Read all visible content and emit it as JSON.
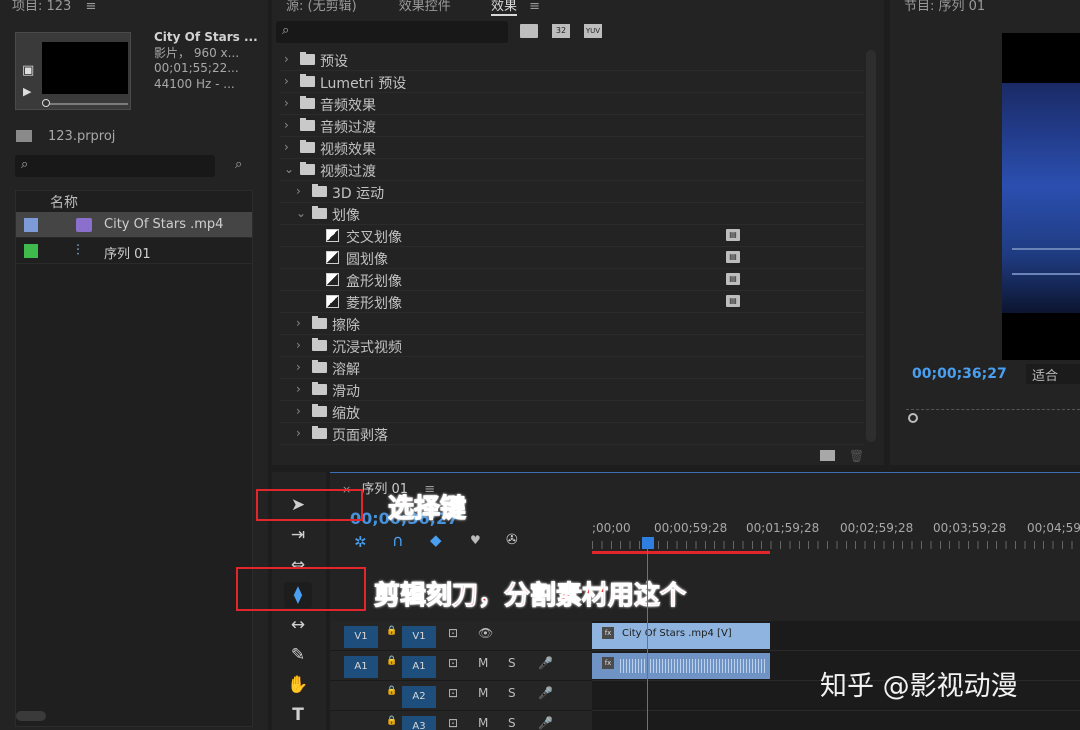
{
  "project": {
    "header": "项目: 123",
    "menu_icon": "≡",
    "clip_name": "City Of Stars ...",
    "meta_line1": "影片， 960 x...",
    "meta_line2": "00;01;55;22...",
    "meta_line3": "44100 Hz - ...",
    "project_file": "123.prproj",
    "column_name": "名称",
    "items": [
      {
        "label": "City Of Stars .mp4",
        "color": "#7d9bd6"
      },
      {
        "label": "序列 01",
        "color": "#3fba4d"
      }
    ]
  },
  "effects_panel": {
    "tab_source": "源: (无剪辑)",
    "tab_effect_controls": "效果控件",
    "tab_effects": "效果",
    "menu_icon": "≡",
    "badges": [
      "32",
      "YUV"
    ],
    "rows": [
      {
        "label": "预设",
        "level": 0,
        "kind": "star-folder",
        "open": false
      },
      {
        "label": "Lumetri 预设",
        "level": 0,
        "kind": "star-folder",
        "open": false
      },
      {
        "label": "音频效果",
        "level": 0,
        "kind": "folder",
        "open": false
      },
      {
        "label": "音频过渡",
        "level": 0,
        "kind": "folder",
        "open": false
      },
      {
        "label": "视频效果",
        "level": 0,
        "kind": "folder",
        "open": false
      },
      {
        "label": "视频过渡",
        "level": 0,
        "kind": "folder",
        "open": true
      },
      {
        "label": "3D 运动",
        "level": 1,
        "kind": "folder",
        "open": false
      },
      {
        "label": "划像",
        "level": 1,
        "kind": "folder",
        "open": true
      },
      {
        "label": "交叉划像",
        "level": 2,
        "kind": "transition"
      },
      {
        "label": "圆划像",
        "level": 2,
        "kind": "transition"
      },
      {
        "label": "盒形划像",
        "level": 2,
        "kind": "transition"
      },
      {
        "label": "菱形划像",
        "level": 2,
        "kind": "transition"
      },
      {
        "label": "擦除",
        "level": 1,
        "kind": "folder",
        "open": false
      },
      {
        "label": "沉浸式视频",
        "level": 1,
        "kind": "folder",
        "open": false
      },
      {
        "label": "溶解",
        "level": 1,
        "kind": "folder",
        "open": false
      },
      {
        "label": "滑动",
        "level": 1,
        "kind": "folder",
        "open": false
      },
      {
        "label": "缩放",
        "level": 1,
        "kind": "folder",
        "open": false
      },
      {
        "label": "页面剥落",
        "level": 1,
        "kind": "folder",
        "open": false
      }
    ]
  },
  "program_monitor": {
    "header": "节目: 序列 01",
    "timecode": "00;00;36;27",
    "fit": "适合"
  },
  "timeline": {
    "close": "×",
    "tab": "序列 01",
    "menu_icon": "≡",
    "timecode": "00;00;36;27",
    "ruler": [
      ";00;00",
      "00;00;59;28",
      "00;01;59;28",
      "00;02;59;28",
      "00;03;59;28",
      "00;04;59;"
    ],
    "tracks": [
      {
        "src": "V1",
        "dst": "V1",
        "buttons": [
          "⊡",
          "👁"
        ]
      },
      {
        "src": "A1",
        "dst": "A1",
        "buttons": [
          "⊡",
          "M",
          "S",
          "🎤"
        ]
      },
      {
        "src": "",
        "dst": "A2",
        "buttons": [
          "⊡",
          "M",
          "S",
          "🎤"
        ]
      },
      {
        "src": "",
        "dst": "A3",
        "buttons": [
          "⊡",
          "M",
          "S",
          "🎤"
        ]
      }
    ],
    "video_clip": "City Of Stars .mp4 [V]"
  },
  "annotations": {
    "select_key": "选择键",
    "razor": "剪辑刻刀，分割素材用这个"
  },
  "watermark": "知乎 @影视动漫",
  "colors": {
    "annotation": "#e62a2e",
    "playhead": "#2f7fe0",
    "clip": "#8eb4df"
  }
}
